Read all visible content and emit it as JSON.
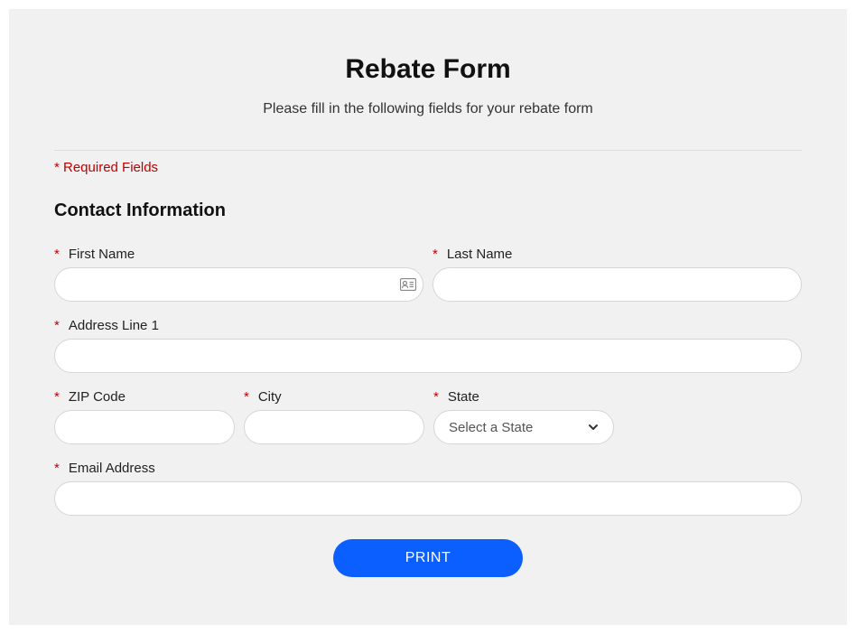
{
  "title": "Rebate Form",
  "subtitle": "Please fill in the following fields for your rebate form",
  "required_note": "* Required Fields",
  "section_title": "Contact Information",
  "required_marker": "*",
  "fields": {
    "first_name": {
      "label": "First Name",
      "value": ""
    },
    "last_name": {
      "label": "Last Name",
      "value": ""
    },
    "address1": {
      "label": "Address Line 1",
      "value": ""
    },
    "zip": {
      "label": "ZIP Code",
      "value": ""
    },
    "city": {
      "label": "City",
      "value": ""
    },
    "state": {
      "label": "State",
      "placeholder": "Select a State",
      "value": ""
    },
    "email": {
      "label": "Email Address",
      "value": ""
    }
  },
  "buttons": {
    "print": "PRINT"
  }
}
